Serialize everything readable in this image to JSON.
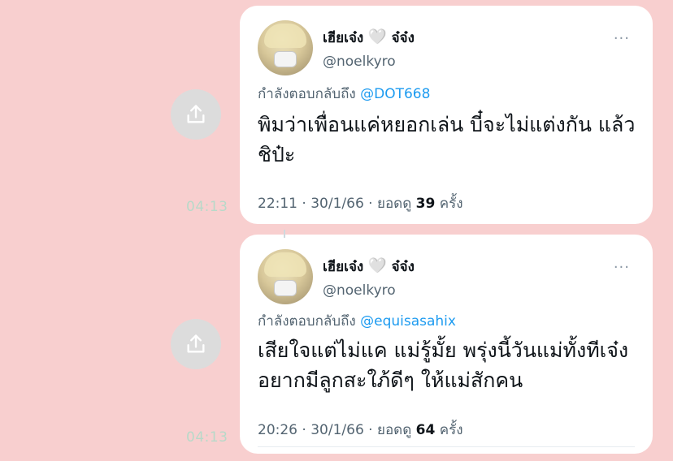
{
  "posts": [
    {
      "display_name": "เฮียเจ๋ง",
      "heart": "🤍",
      "display_name_suffix": "จ๋จ๋ง",
      "handle": "@noelkyro",
      "more": "···",
      "reply_prefix": "กำลังตอบกลับถึง",
      "reply_mention": "@DOT668",
      "text": "พิมว่าเพื่อนแค่หยอกเล่น บี๋จะไม่แต่งกัน แล้วชิป๋ะ",
      "time": "22:11",
      "date": "30/1/66",
      "views_label": "ยอดดู",
      "views_count": "39",
      "views_unit": "ครั้ง",
      "side_time": "04:13"
    },
    {
      "display_name": "เฮียเจ๋ง",
      "heart": "🤍",
      "display_name_suffix": "จ๋จ๋ง",
      "handle": "@noelkyro",
      "more": "···",
      "reply_prefix": "กำลังตอบกลับถึง",
      "reply_mention": "@equisasahix",
      "text": "เสียใจแต่ไม่แค แม่รู้มั้ย พรุ่งนี้วันแม่ทั้งทีเจ๋งอยากมีลูกสะใภ้ดีๆ ให้แม่สักคน",
      "time": "20:26",
      "date": "30/1/66",
      "views_label": "ยอดดู",
      "views_count": "64",
      "views_unit": "ครั้ง",
      "side_time": "04:13"
    }
  ],
  "icons": {
    "share": "share-icon"
  }
}
